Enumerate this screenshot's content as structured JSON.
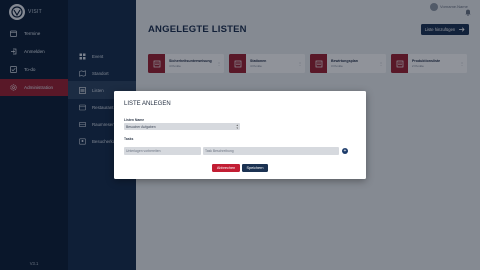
{
  "app": {
    "logo_text": "VISIT",
    "version": "V3.1"
  },
  "sidebar": {
    "items": [
      {
        "label": "Termine",
        "icon": "calendar-icon"
      },
      {
        "label": "Anmelden",
        "icon": "login-icon"
      },
      {
        "label": "To-do",
        "icon": "checklist-icon"
      },
      {
        "label": "Administration",
        "icon": "settings-icon"
      }
    ]
  },
  "subnav": {
    "items": [
      {
        "label": "Event",
        "icon": "grid-icon"
      },
      {
        "label": "Standort",
        "icon": "map-icon"
      },
      {
        "label": "Listen",
        "icon": "list-icon"
      },
      {
        "label": "Restaurant",
        "icon": "restaurant-icon"
      },
      {
        "label": "Raumreservierung",
        "icon": "room-icon"
      },
      {
        "label": "Besucherkategorien",
        "icon": "visitor-icon"
      }
    ]
  },
  "header": {
    "username": "Vorname.Name",
    "title": "ANGELEGTE LISTEN",
    "add_button": "Liste hinzufügen"
  },
  "cards": [
    {
      "title": "Sicherheitsunterweisung",
      "subtitle": "4 Punkte"
    },
    {
      "title": "Stationen",
      "subtitle": "4 Punkte"
    },
    {
      "title": "Bewirtungsplan",
      "subtitle": "3 Punkte"
    },
    {
      "title": "Produktionsliste",
      "subtitle": "2 Punkte"
    }
  ],
  "modal": {
    "title": "LISTE ANLEGEN",
    "name_label": "Listen Name",
    "name_value": "Besucher Aufgaben",
    "tasks_label": "Tasks",
    "task_title_value": "Unterlagen vorbereiten",
    "task_desc_placeholder": "Task Beschreibung",
    "cancel_label": "Abbrechen",
    "save_label": "Speichern"
  },
  "colors": {
    "accent": "#9b2030",
    "navy": "#1b3252"
  }
}
